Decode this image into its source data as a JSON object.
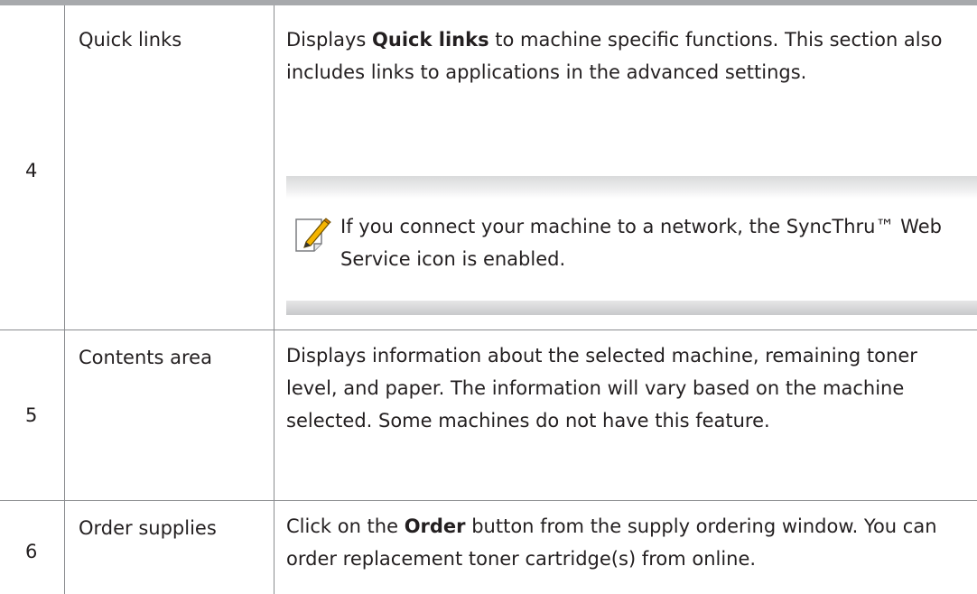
{
  "rows": [
    {
      "number": "4",
      "term": "Quick links",
      "desc_pre": "Displays ",
      "desc_bold": "Quick links",
      "desc_post": " to machine specific functions. This section also includes links to applications in the advanced settings.",
      "note": {
        "icon": "note-pencil-icon",
        "text": "If you connect your machine to a network, the SyncThru™ Web Service icon is enabled."
      }
    },
    {
      "number": "5",
      "term": "Contents area",
      "desc": "Displays information about the selected machine, remaining toner level, and paper. The information will vary based on the machine selected. Some machines do not have this feature."
    },
    {
      "number": "6",
      "term": "Order supplies",
      "desc_pre": "Click on the ",
      "desc_bold": "Order",
      "desc_post": " button from the supply ordering window. You can order replacement toner cartridge(s) from online."
    }
  ],
  "colors": {
    "text": "#231f20",
    "rule": "#a7a9ac",
    "grid": "#8a8c8f",
    "icon_accent": "#f5b400"
  }
}
